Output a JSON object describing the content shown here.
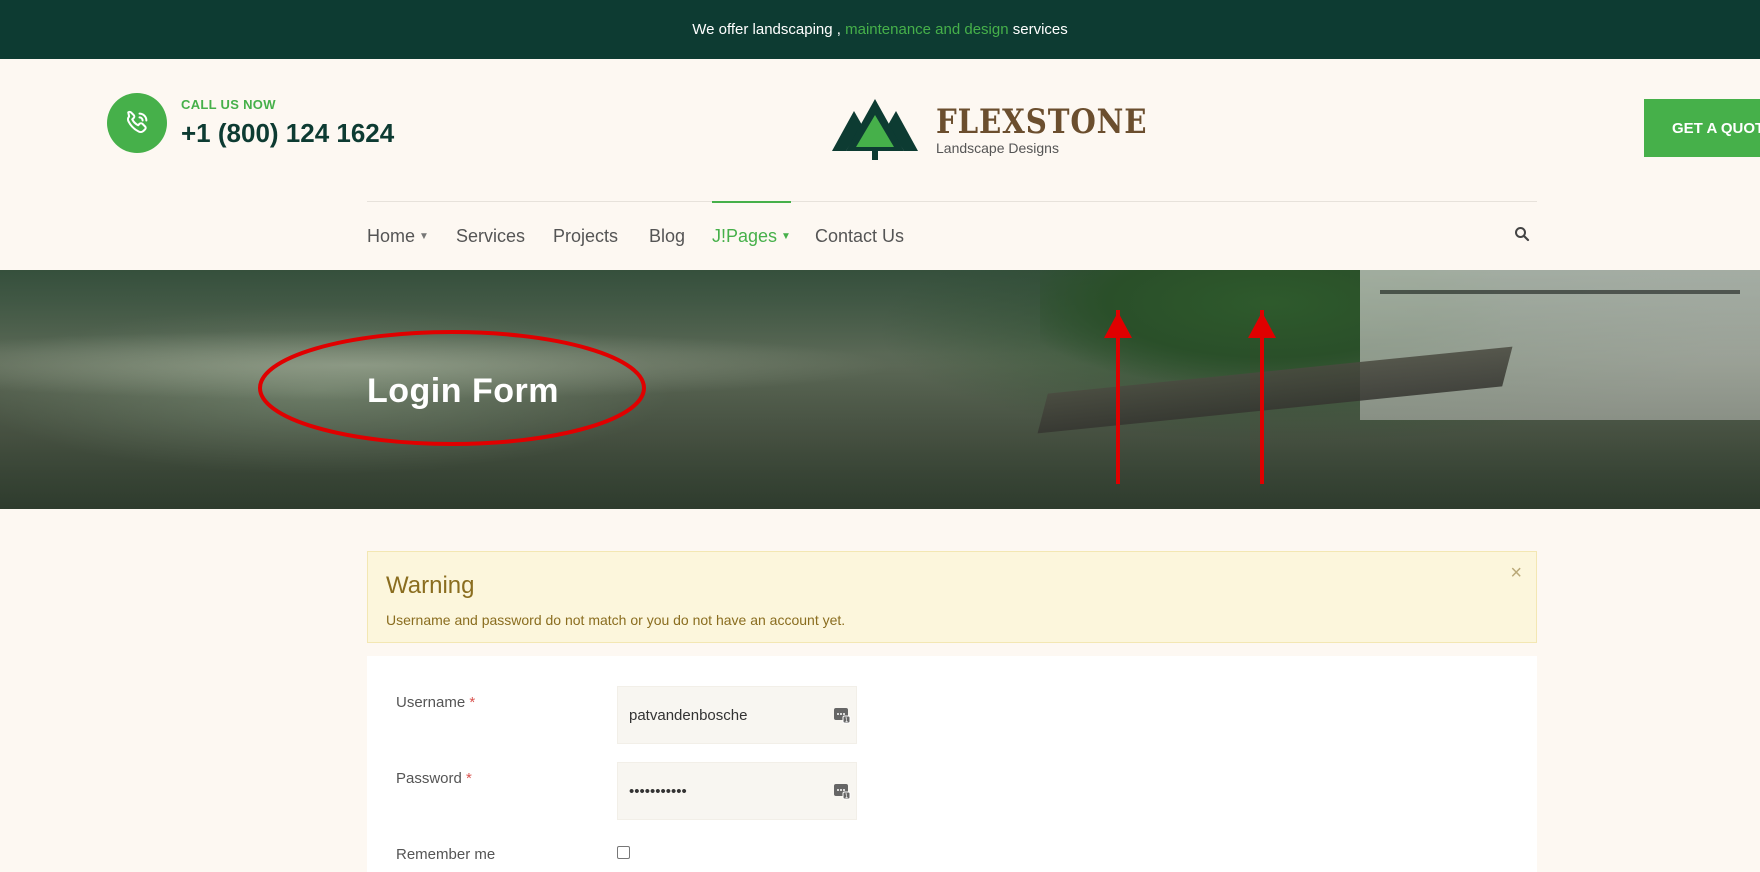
{
  "topbar": {
    "prefix": "We offer landscaping ,",
    "highlight": "maintenance and design",
    "suffix": "services"
  },
  "header": {
    "call_label": "CALL US NOW",
    "phone": "+1 (800) 124 1624",
    "logo_name": "FLEXSTONE",
    "logo_subtitle": "Landscape Designs",
    "quote_button": "GET A QUOTE"
  },
  "nav": {
    "items": [
      {
        "label": "Home",
        "has_caret": true,
        "active": false
      },
      {
        "label": "Services",
        "has_caret": false,
        "active": false
      },
      {
        "label": "Projects",
        "has_caret": false,
        "active": false
      },
      {
        "label": "Blog",
        "has_caret": false,
        "active": false
      },
      {
        "label": "J!Pages",
        "has_caret": true,
        "active": true
      },
      {
        "label": "Contact Us",
        "has_caret": false,
        "active": false
      }
    ],
    "search_icon": "search-icon"
  },
  "hero": {
    "title": "Login Form"
  },
  "alert": {
    "heading": "Warning",
    "message": "Username and password do not match or you do not have an account yet.",
    "close": "×"
  },
  "form": {
    "username_label": "Username",
    "username_value": "patvandenbosche",
    "password_label": "Password",
    "password_value": "wwwwwwwwwww",
    "remember_label": "Remember me",
    "required_mark": "*"
  },
  "colors": {
    "topbar_bg": "#0d3b32",
    "accent_green": "#46b04a",
    "page_bg": "#fdf8f2",
    "warning_bg": "#fcf6dc",
    "warning_text": "#8a6d1f",
    "annotation_red": "#e00000"
  }
}
